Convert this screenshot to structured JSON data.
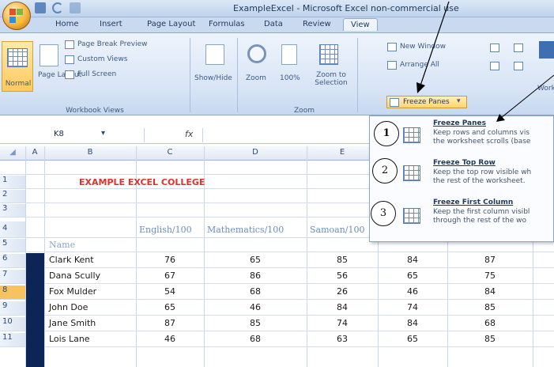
{
  "window": {
    "title": "ExampleExcel - Microsoft Excel non-commercial use"
  },
  "tabs": [
    "Home",
    "Insert",
    "Page Layout",
    "Formulas",
    "Data",
    "Review",
    "View"
  ],
  "ribbon": {
    "workbook_views": {
      "normal": "Normal",
      "page_layout": "Page Layout",
      "page_break_preview": "Page Break Preview",
      "custom_views": "Custom Views",
      "full_screen": "Full Screen",
      "group_title": "Workbook Views"
    },
    "show_hide": "Show/Hide",
    "zoom": {
      "zoom": "Zoom",
      "hundred": "100%",
      "zoom_to_selection": "Zoom to Selection",
      "group_title": "Zoom"
    },
    "window": {
      "new_window": "New Window",
      "arrange_all": "Arrange All",
      "freeze_panes": "Freeze Panes",
      "workspace": "Work"
    }
  },
  "formula_bar": {
    "name_box": "K8",
    "fx": "fx"
  },
  "columns": [
    "A",
    "B",
    "C",
    "D",
    "E"
  ],
  "rows": [
    "1",
    "2",
    "3",
    "4",
    "5",
    "6",
    "7",
    "8",
    "9",
    "10",
    "11"
  ],
  "sheet": {
    "title": "EXAMPLE EXCEL COLLEGE",
    "headers": [
      "English/100",
      "Mathematics/100",
      "Samoan/100"
    ],
    "name_label": "Name",
    "students": [
      {
        "name": "Clark Kent",
        "scores": [
          "76",
          "65",
          "85",
          "84",
          "87"
        ]
      },
      {
        "name": "Dana Scully",
        "scores": [
          "67",
          "86",
          "56",
          "65",
          "75"
        ]
      },
      {
        "name": "Fox Mulder",
        "scores": [
          "54",
          "68",
          "26",
          "46",
          "84"
        ]
      },
      {
        "name": "John Doe",
        "scores": [
          "65",
          "46",
          "84",
          "74",
          "85"
        ]
      },
      {
        "name": "Jane Smith",
        "scores": [
          "87",
          "85",
          "74",
          "84",
          "68"
        ]
      },
      {
        "name": "Lois Lane",
        "scores": [
          "46",
          "68",
          "63",
          "65",
          "85"
        ]
      }
    ]
  },
  "freeze_menu": [
    {
      "num": "1",
      "title": "Freeze Panes",
      "desc1": "Keep rows and columns vis",
      "desc2": "the worksheet scrolls (base"
    },
    {
      "num": "2",
      "title": "Freeze Top Row",
      "desc1": "Keep the top row visible wh",
      "desc2": "the rest of the worksheet."
    },
    {
      "num": "3",
      "title": "Freeze First Column",
      "desc1": "Keep the first column visibl",
      "desc2": "through the rest of the wo"
    }
  ],
  "colors": {
    "title_red": "#e0312b",
    "accent_orange": "#f7c35e",
    "row_bar": "#0d2456"
  }
}
